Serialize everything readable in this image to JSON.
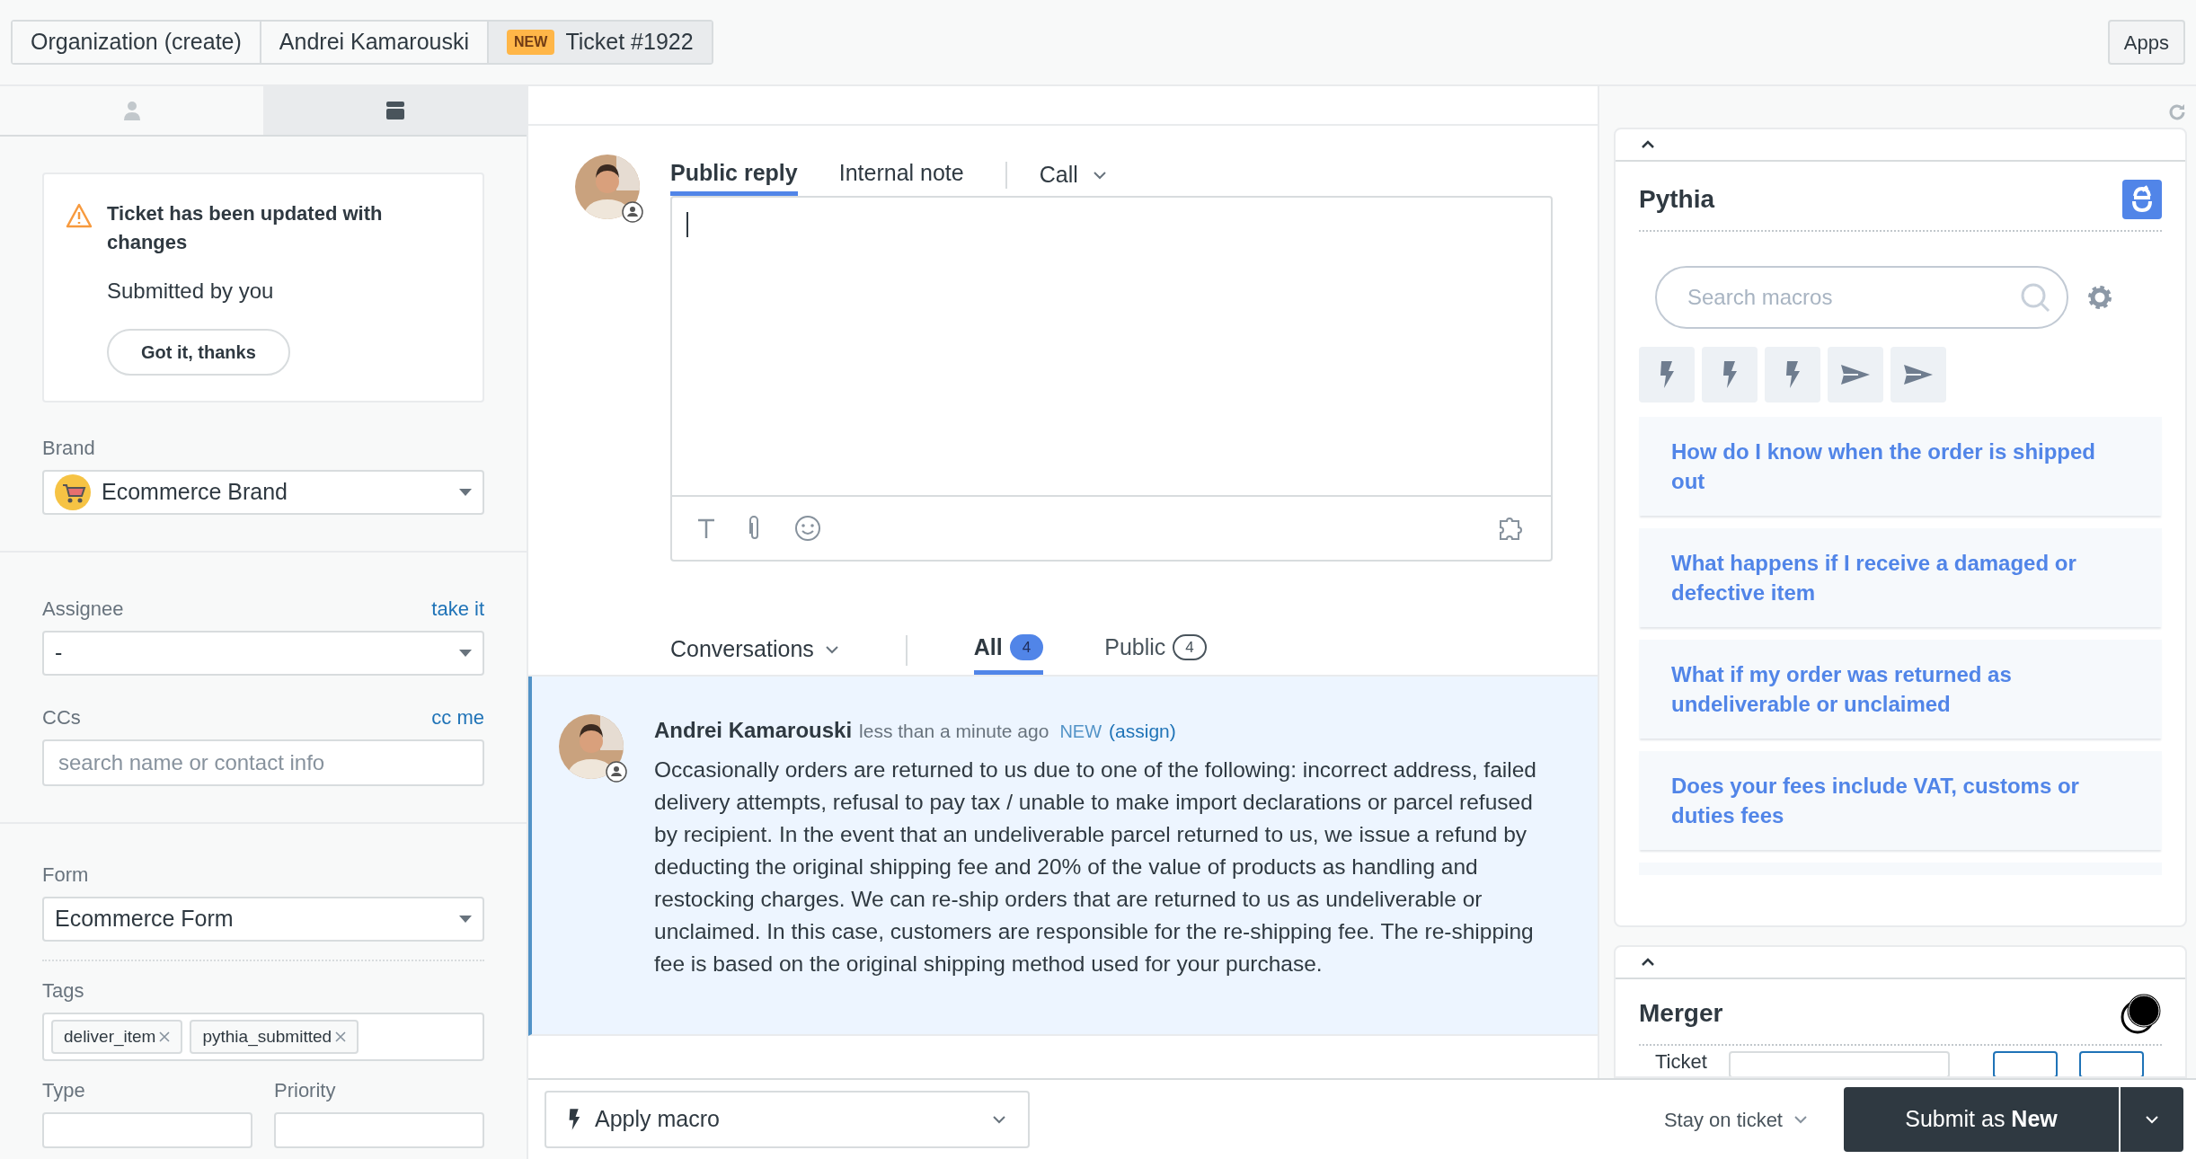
{
  "top_tabs": [
    {
      "label": "Organization (create)",
      "selected": false
    },
    {
      "label": "Andrei Kamarouski",
      "selected": false
    },
    {
      "badge": "NEW",
      "label": "Ticket #1922",
      "selected": true
    }
  ],
  "apps_button": "Apps",
  "sidebar": {
    "tabs": [
      {
        "kind": "person",
        "selected": false
      },
      {
        "kind": "card",
        "selected": true
      }
    ],
    "alert": {
      "title": "Ticket has been updated with changes",
      "text": "Submitted by you",
      "button": "Got it, thanks"
    },
    "brand": {
      "label": "Brand",
      "value": "Ecommerce Brand"
    },
    "assignee": {
      "label": "Assignee",
      "link": "take it",
      "value": "-"
    },
    "ccs": {
      "label": "CCs",
      "link": "cc me",
      "placeholder": "search name or contact info"
    },
    "form": {
      "label": "Form",
      "value": "Ecommerce Form"
    },
    "tags": {
      "label": "Tags",
      "items": [
        "deliver_item",
        "pythia_submitted"
      ]
    },
    "type": {
      "label": "Type"
    },
    "priority": {
      "label": "Priority"
    }
  },
  "composer": {
    "tabs": [
      {
        "label": "Public reply",
        "selected": true
      },
      {
        "label": "Internal note",
        "selected": false
      }
    ],
    "channel": "Call"
  },
  "conversation_filter": {
    "label": "Conversations",
    "tabs": [
      {
        "label": "All",
        "count": "4",
        "selected": true
      },
      {
        "label": "Public",
        "count": "4",
        "selected": false
      }
    ]
  },
  "message": {
    "author": "Andrei Kamarouski",
    "time": "less than a minute ago",
    "status": "NEW",
    "action": "(assign)",
    "body": "Occasionally orders are returned to us due to one of the following: incorrect address, failed delivery attempts, refusal to pay tax / unable to make import declarations or parcel refused by recipient. In the event that an undeliverable parcel returned to us, we issue a refund by deducting the original shipping fee and 20% of the value of products as handling and restocking charges. We can re-ship orders that are returned to us as undeliverable or unclaimed. In this case, customers are responsible for the re-shipping fee. The re-shipping fee is based on the original shipping method used for your purchase."
  },
  "apply_macro": "Apply macro",
  "pythia": {
    "title": "Pythia",
    "search_placeholder": "Search macros",
    "quick_actions": [
      {
        "kind": "bolt"
      },
      {
        "kind": "bolt"
      },
      {
        "kind": "bolt"
      },
      {
        "kind": "send"
      },
      {
        "kind": "send"
      }
    ],
    "macros": [
      "How do I know when the order is shipped out",
      "What happens if I receive a damaged or defective item",
      "What if my order was returned as undeliverable or unclaimed",
      "Does your fees include VAT, customs or duties fees"
    ]
  },
  "merger": {
    "title": "Merger",
    "field_label": "Ticket"
  },
  "footer": {
    "stay": "Stay on ticket",
    "submit": "Submit as **New**"
  }
}
